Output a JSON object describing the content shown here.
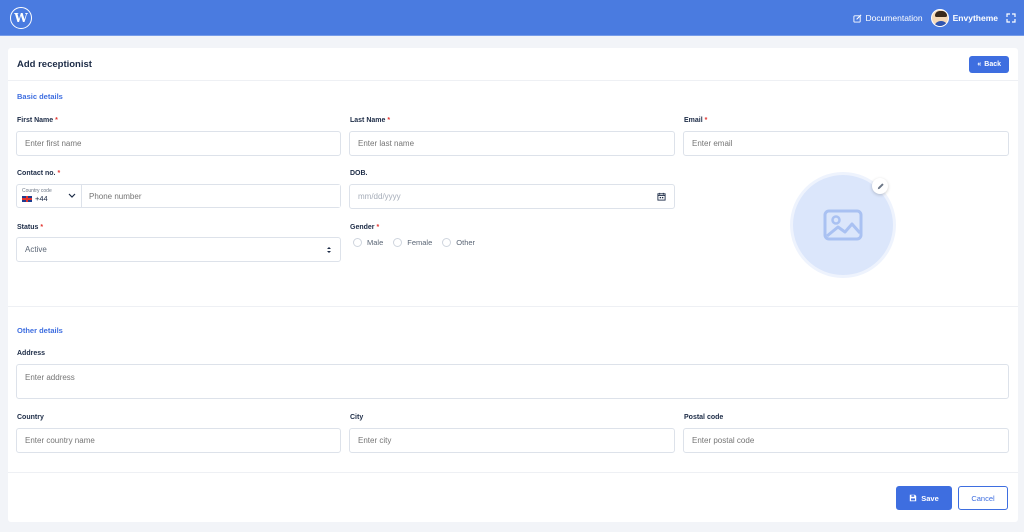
{
  "topbar": {
    "logo_icon": "wordpress-logo-icon",
    "documentation_label": "Documentation",
    "user_name": "Envytheme"
  },
  "card": {
    "title": "Add receptionist",
    "back_label": "Back"
  },
  "basic": {
    "section_title": "Basic details",
    "first_name": {
      "label": "First Name",
      "placeholder": "Enter first name"
    },
    "last_name": {
      "label": "Last Name",
      "placeholder": "Enter last name"
    },
    "email": {
      "label": "Email",
      "placeholder": "Enter email"
    },
    "contact": {
      "label": "Contact no.",
      "country_code_label": "Country code",
      "country_code_value": "+44",
      "placeholder": "Phone number"
    },
    "dob": {
      "label": "DOB.",
      "placeholder": "mm/dd/yyyy"
    },
    "status": {
      "label": "Status",
      "value": "Active"
    },
    "gender": {
      "label": "Gender",
      "options": [
        "Male",
        "Female",
        "Other"
      ]
    }
  },
  "other": {
    "section_title": "Other details",
    "address": {
      "label": "Address",
      "placeholder": "Enter address"
    },
    "country": {
      "label": "Country",
      "placeholder": "Enter country name"
    },
    "city": {
      "label": "City",
      "placeholder": "Enter city"
    },
    "postal": {
      "label": "Postal code",
      "placeholder": "Enter postal code"
    }
  },
  "actions": {
    "save_label": "Save",
    "cancel_label": "Cancel"
  },
  "required_mark": "*",
  "colors": {
    "topbar": "#4a7be0",
    "accent": "#3e6ee0",
    "required": "#e3342f",
    "background": "#f2f4f8"
  }
}
